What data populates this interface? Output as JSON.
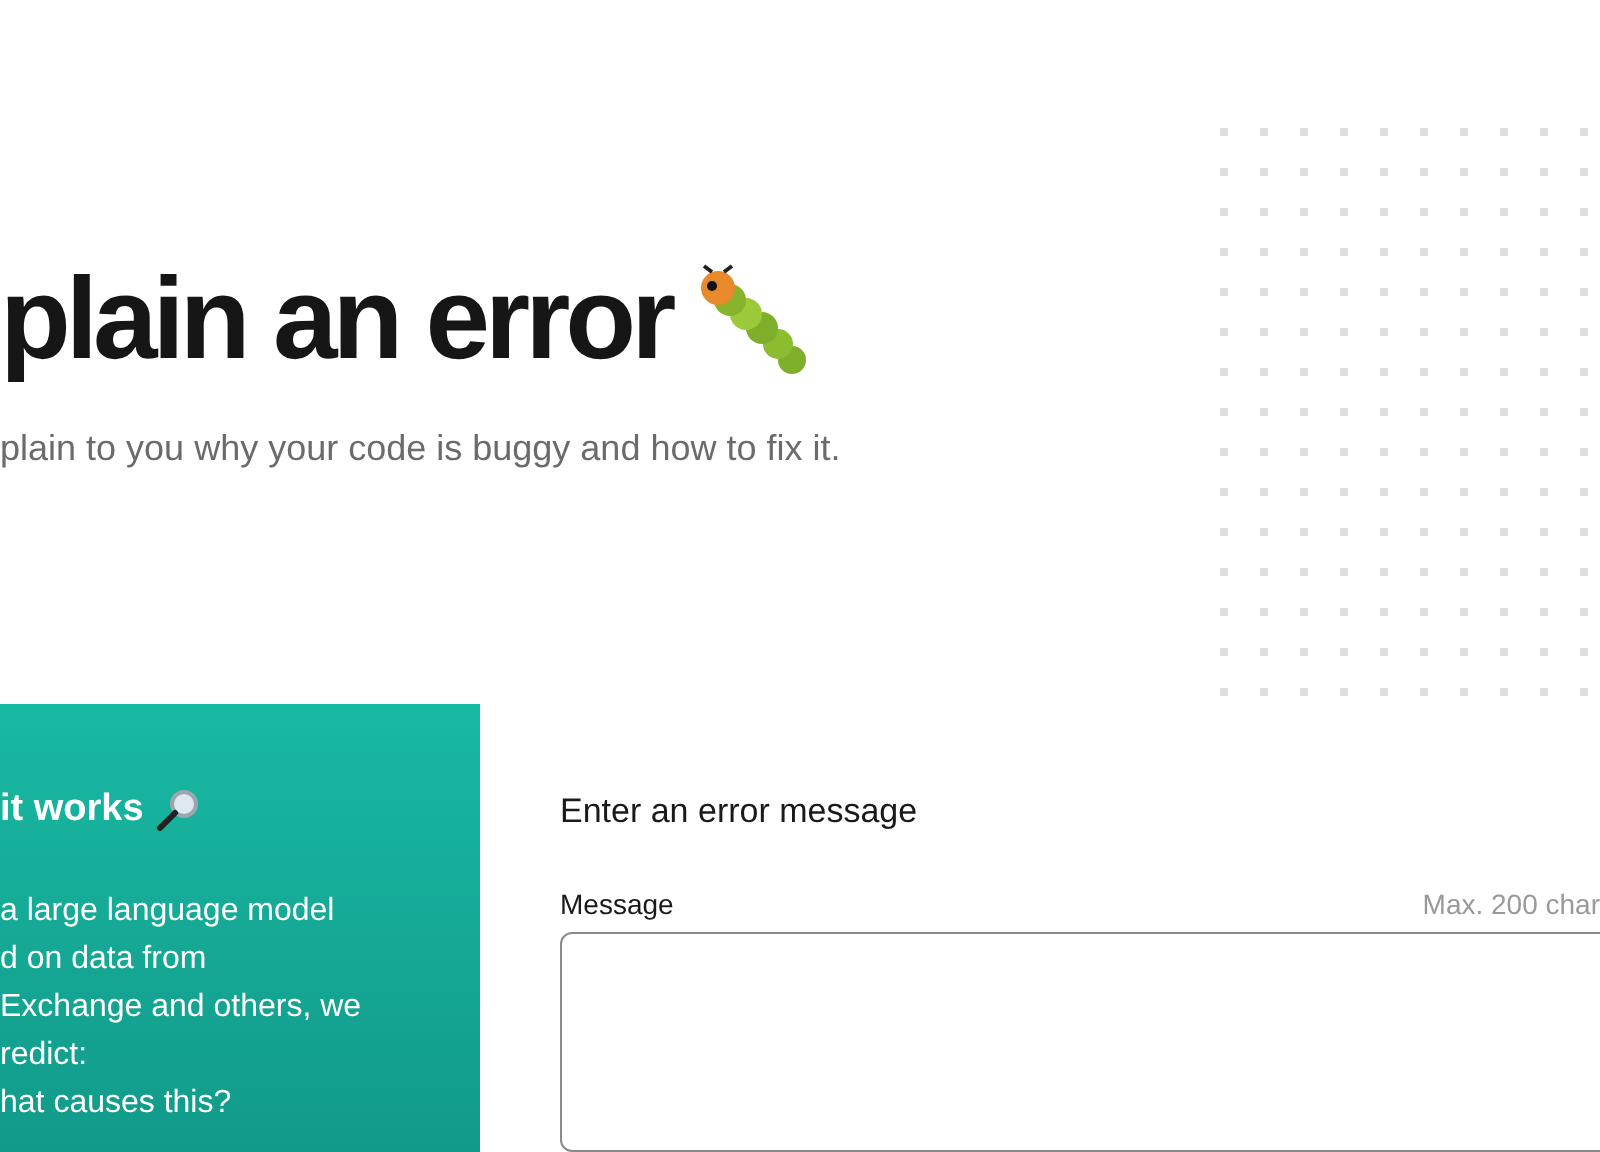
{
  "hero": {
    "title": "plain an error",
    "subtitle": "plain to you why your code is buggy and how to fix it."
  },
  "info_panel": {
    "heading": "it works",
    "lines": [
      "a large language model",
      "d on data from",
      "Exchange and others, we",
      "redict:",
      "hat causes this?"
    ]
  },
  "form": {
    "heading": "Enter an error message",
    "field": {
      "label": "Message",
      "hint": "Max. 200 char"
    }
  }
}
